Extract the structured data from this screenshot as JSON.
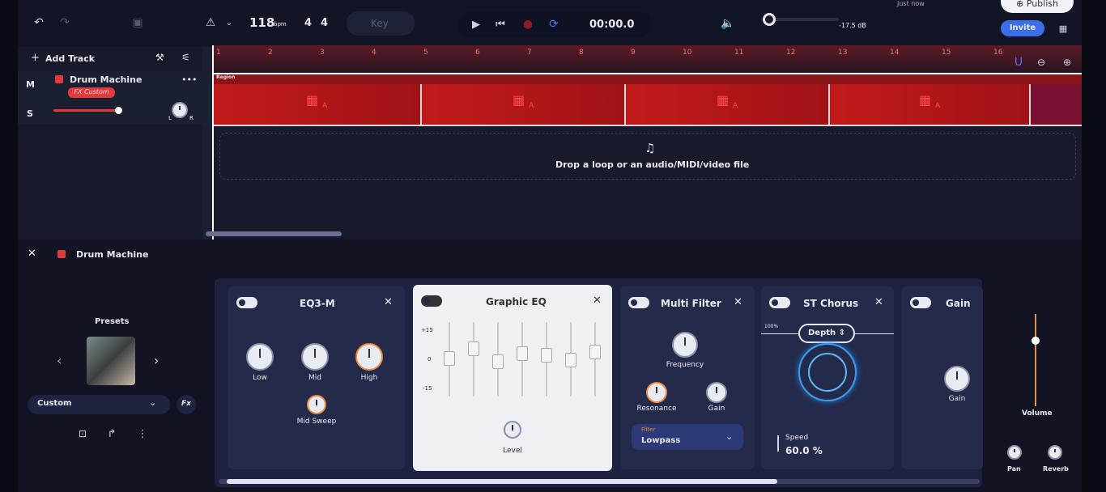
{
  "topbar": {
    "undo_icon": "undo-icon",
    "bpm_value": "118",
    "bpm_unit": "bpm",
    "time_sig_top": "4",
    "time_sig_bottom": "4",
    "key_placeholder": "Key",
    "time_display": "00:00.0",
    "volume_db": "-17.5 dB",
    "status": "Just now",
    "publish_label": "Publish",
    "invite_label": "Invite"
  },
  "tracks": {
    "add_track_label": "Add Track",
    "mute_label": "M",
    "solo_label": "S",
    "track_name": "Drum Machine",
    "fx_badge": "FX Custom",
    "more_label": "•••",
    "pan_left": "L",
    "pan_right": "R"
  },
  "ruler": {
    "bars": [
      "1",
      "2",
      "3",
      "4",
      "5",
      "6",
      "7",
      "8",
      "9",
      "10",
      "11",
      "12",
      "13",
      "14",
      "15",
      "16"
    ]
  },
  "regions": {
    "label": "Region",
    "clip_label": "A",
    "drop_text": "Drop a loop or an audio/MIDI/video file"
  },
  "panel": {
    "instrument_name": "Drum Machine",
    "presets_label": "Presets",
    "preset_value": "Custom",
    "fx_label": "Fx",
    "eq3": {
      "title": "EQ3-M",
      "low": "Low",
      "mid": "Mid",
      "high": "High",
      "mid_sweep": "Mid Sweep"
    },
    "graphic_eq": {
      "title": "Graphic EQ",
      "scale_top": "+15",
      "scale_mid": "0",
      "scale_bottom": "-15",
      "level": "Level"
    },
    "multi_filter": {
      "title": "Multi Filter",
      "frequency": "Frequency",
      "resonance": "Resonance",
      "gain": "Gain",
      "filter_label": "Filter",
      "filter_value": "Lowpass"
    },
    "chorus": {
      "title": "ST Chorus",
      "depth_label": "Depth",
      "depth_value": "100%",
      "speed_label": "Speed",
      "speed_value": "60.0 %"
    },
    "gain_module": {
      "title": "Gain",
      "gain": "Gain"
    },
    "volume_label": "Volume",
    "pan_label": "Pan",
    "reverb_label": "Reverb"
  },
  "colors": {
    "accent": "#3b6ee8",
    "region_red": "#c21a1a",
    "background": "#161a2a",
    "orange": "#f08a3c"
  }
}
